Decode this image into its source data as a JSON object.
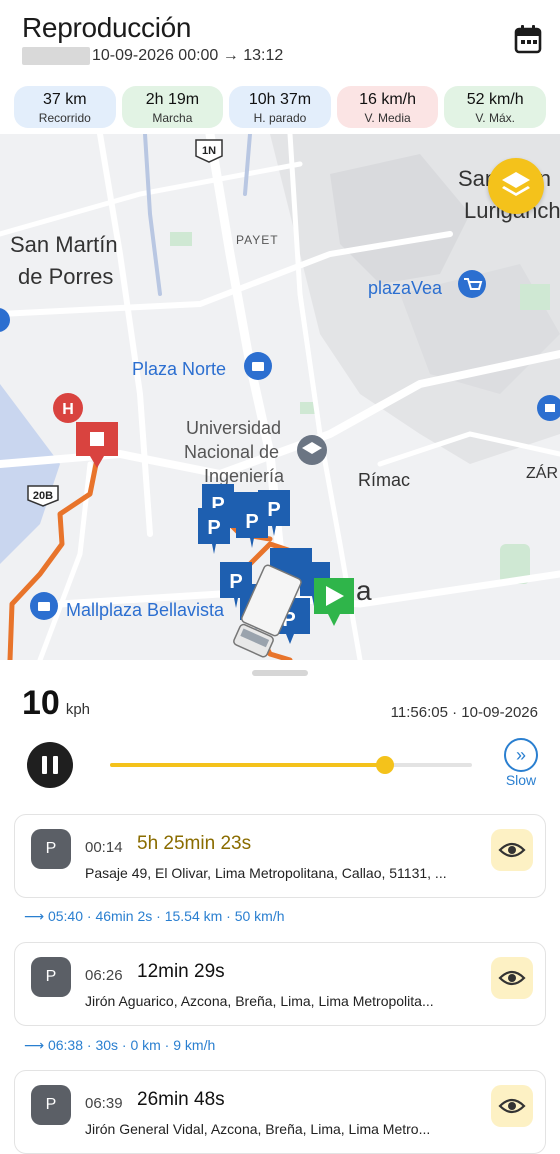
{
  "header": {
    "title": "Reproducción",
    "date_range": "10-09-2026 00:00 → 13:12"
  },
  "stats": [
    {
      "value": "37 km",
      "label": "Recorrido",
      "bg": "#e3eefb"
    },
    {
      "value": "2h 19m",
      "label": "Marcha",
      "bg": "#e2f3e4"
    },
    {
      "value": "10h 37m",
      "label": "H. parado",
      "bg": "#e3eefb"
    },
    {
      "value": "16 km/h",
      "label": "V. Media",
      "bg": "#fbe4e4"
    },
    {
      "value": "52 km/h",
      "label": "V. Máx.",
      "bg": "#e2f3e4"
    }
  ],
  "map": {
    "labels": {
      "san_martin": "San Martín de Porres",
      "payet": "PAYET",
      "plaza_norte": "Plaza Norte",
      "plaza_vea": "plazaVea",
      "uni": "Universidad Nacional de Ingeniería",
      "rimac": "Rímac",
      "zarate": "ZÁR",
      "mallplaza": "Mallplaza Bellavista",
      "sj_lurigancho": "San Juan de Lurigancho",
      "lima": "a",
      "road_1n": "1N",
      "road_20b": "20B"
    },
    "route_color": "#e8742b",
    "accent": "#f4c21b"
  },
  "player": {
    "speed_value": "10",
    "speed_unit": "kph",
    "timestamp": "11:56:05 · 10-09-2026",
    "progress": 0.76,
    "speed_mode": "Slow"
  },
  "stops": [
    {
      "badge": "P",
      "time": "00:14",
      "duration": "5h 25min 23s",
      "address": "Pasaje 49, El Olivar, Lima Metropolitana, Callao, 51131, ..."
    },
    {
      "badge": "P",
      "time": "06:26",
      "duration": "12min 29s",
      "address": "Jirón Aguarico, Azcona, Breña, Lima, Lima Metropolita..."
    },
    {
      "badge": "P",
      "time": "06:39",
      "duration": "26min 48s",
      "address": "Jirón General Vidal, Azcona, Breña, Lima, Lima Metro..."
    }
  ],
  "segments": [
    {
      "text": "05:40 · 46min 2s · 15.54 km · 50 km/h"
    },
    {
      "text": "06:38 · 30s · 0 km · 9 km/h"
    }
  ]
}
